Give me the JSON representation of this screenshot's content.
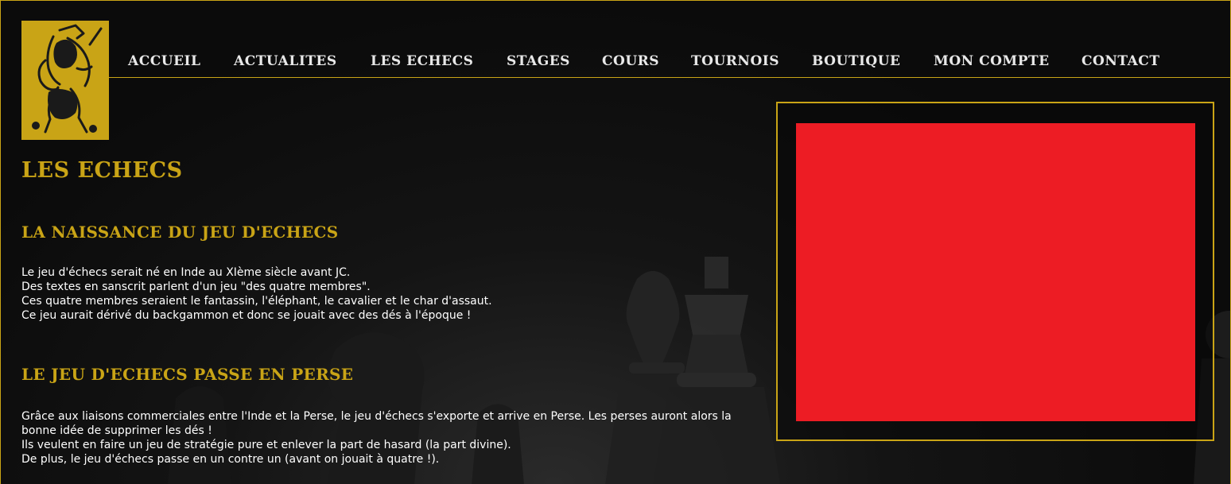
{
  "nav": {
    "items": [
      {
        "label": "ACCUEIL"
      },
      {
        "label": "ACTUALITES"
      },
      {
        "label": "LES ECHECS"
      },
      {
        "label": "STAGES"
      },
      {
        "label": "COURS"
      },
      {
        "label": "TOURNOIS"
      },
      {
        "label": "BOUTIQUE"
      },
      {
        "label": "MON COMPTE"
      },
      {
        "label": "CONTACT"
      }
    ]
  },
  "page": {
    "title": "LES ECHECS",
    "sections": [
      {
        "title": "LA NAISSANCE DU JEU D'ECHECS",
        "lines": [
          "Le jeu d'échecs serait né en Inde au XIème siècle avant JC.",
          "Des textes en sanscrit parlent d'un jeu \"des quatre membres\".",
          "Ces quatre membres seraient le fantassin, l'éléphant, le cavalier et le char d'assaut.",
          "Ce jeu aurait dérivé du backgammon et donc se jouait avec des dés à l'époque !"
        ]
      },
      {
        "title": "LE JEU D'ECHECS PASSE EN PERSE",
        "lines": [
          "Grâce aux liaisons commerciales entre l'Inde et la Perse, le jeu d'échecs s'exporte et arrive en Perse. Les perses auront alors la bonne idée de supprimer les dés !",
          "Ils veulent en faire un jeu de stratégie pure et enlever la part de hasard (la part divine).",
          "De plus, le jeu d'échecs passe en un contre un (avant on jouait à quatre !)."
        ]
      }
    ]
  },
  "colors": {
    "accent": "#c9a416",
    "background": "#0b0b0b",
    "media_placeholder": "#ed1c24"
  },
  "icons": {
    "logo": "knight-warrior-logo"
  }
}
